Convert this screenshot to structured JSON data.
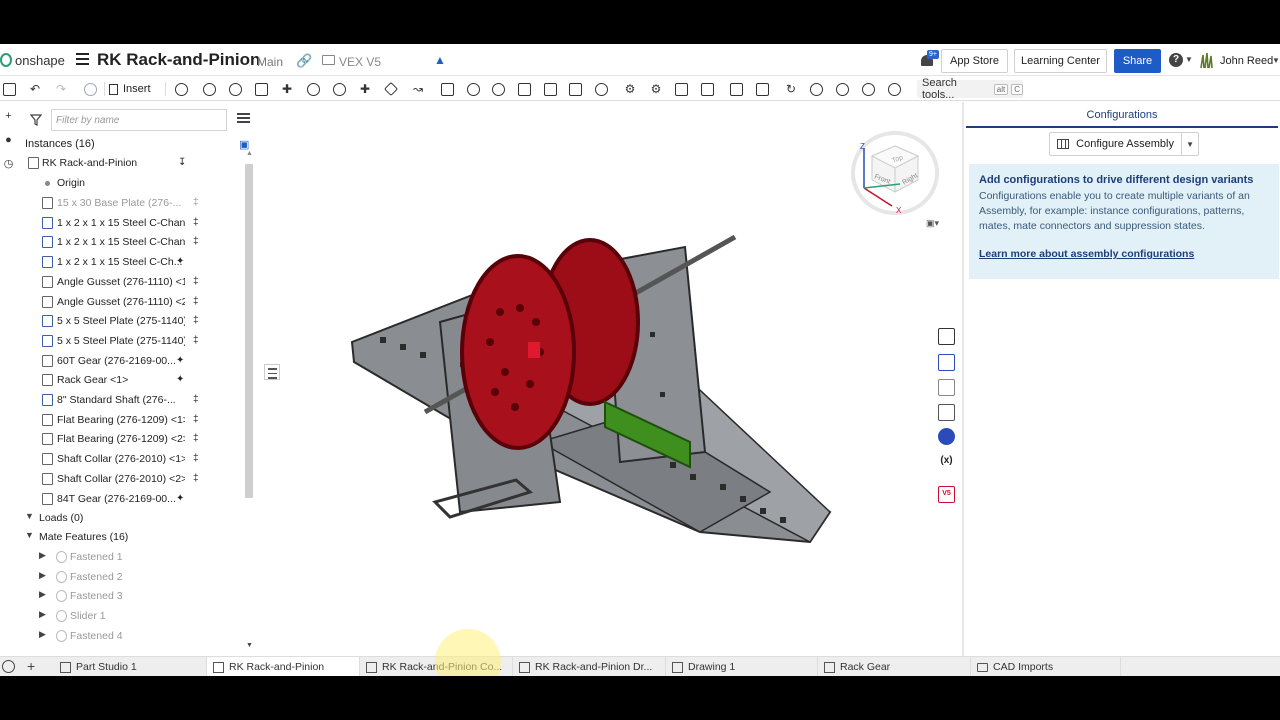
{
  "brand": {
    "name": "onshape"
  },
  "document": {
    "title": "RK Rack-and-Pinion",
    "branch": "Main",
    "folder": "VEX V5"
  },
  "header": {
    "notification_badge": "9+",
    "app_store": "App Store",
    "learning_center": "Learning Center",
    "share": "Share",
    "user_name": "John Reed"
  },
  "toolbar": {
    "insert_label": "Insert",
    "search_label": "Search tools...",
    "search_keys": [
      "alt",
      "C"
    ]
  },
  "feature_panel": {
    "filter_placeholder": "Filter by name",
    "instances_header": "Instances (16)",
    "root_item": "RK Rack-and-Pinion",
    "origin_label": "Origin",
    "instances": [
      {
        "label": "15 x 30 Base Plate (276-...",
        "dim": true
      },
      {
        "label": "1 x 2 x 1 x 15 Steel C-Chann...",
        "dim": false
      },
      {
        "label": "1 x 2 x 1 x 15 Steel C-Chann...",
        "dim": false
      },
      {
        "label": "1 x 2 x 1 x 15 Steel C-Ch...",
        "dim": false
      },
      {
        "label": "Angle Gusset (276-1110) <1>",
        "dim": false
      },
      {
        "label": "Angle Gusset (276-1110) <2>",
        "dim": false
      },
      {
        "label": "5 x 5 Steel Plate (275-1140)...",
        "dim": false
      },
      {
        "label": "5 x 5 Steel Plate (275-1140)...",
        "dim": false
      },
      {
        "label": "60T Gear (276-2169-00...",
        "dim": false
      },
      {
        "label": "Rack Gear <1>",
        "dim": false
      },
      {
        "label": "8\" Standard Shaft (276-...",
        "dim": false
      },
      {
        "label": "Flat Bearing (276-1209) <1>",
        "dim": false
      },
      {
        "label": "Flat Bearing (276-1209) <2>",
        "dim": false
      },
      {
        "label": "Shaft Collar (276-2010) <1>",
        "dim": false
      },
      {
        "label": "Shaft Collar (276-2010) <2>",
        "dim": false
      },
      {
        "label": "84T Gear (276-2169-00...",
        "dim": false
      }
    ],
    "loads_header": "Loads (0)",
    "mates_header": "Mate Features (16)",
    "mates": [
      "Fastened 1",
      "Fastened 2",
      "Fastened 3",
      "Slider 1",
      "Fastened 4"
    ]
  },
  "configurations": {
    "tab_title": "Configurations",
    "configure_button": "Configure Assembly",
    "info_heading": "Add configurations to drive different design variants",
    "info_body": "Configurations enable you to create multiple variants of an Assembly, for example: instance configurations, patterns, mates, mate connectors and suppression states.",
    "info_link": "Learn more about assembly configurations"
  },
  "view_cube": {
    "top": "Top",
    "front": "Front",
    "right": "Right",
    "z_axis": "Z",
    "x_axis": "X"
  },
  "tabs": [
    {
      "label": "Part Studio 1",
      "active": false
    },
    {
      "label": "RK Rack-and-Pinion",
      "active": true
    },
    {
      "label": "RK Rack-and-Pinion Co...",
      "active": false
    },
    {
      "label": "RK Rack-and-Pinion Dr...",
      "active": false
    },
    {
      "label": "Drawing 1",
      "active": false
    },
    {
      "label": "Rack Gear",
      "active": false
    },
    {
      "label": "CAD Imports",
      "active": false
    }
  ],
  "colors": {
    "brand_green": "#2aa06f",
    "share_blue": "#1e5bc6",
    "gear_red": "#a8101b",
    "rack_green": "#3f8f1f",
    "steel": "#8a8e93",
    "info_bg": "#e2f1f8"
  }
}
